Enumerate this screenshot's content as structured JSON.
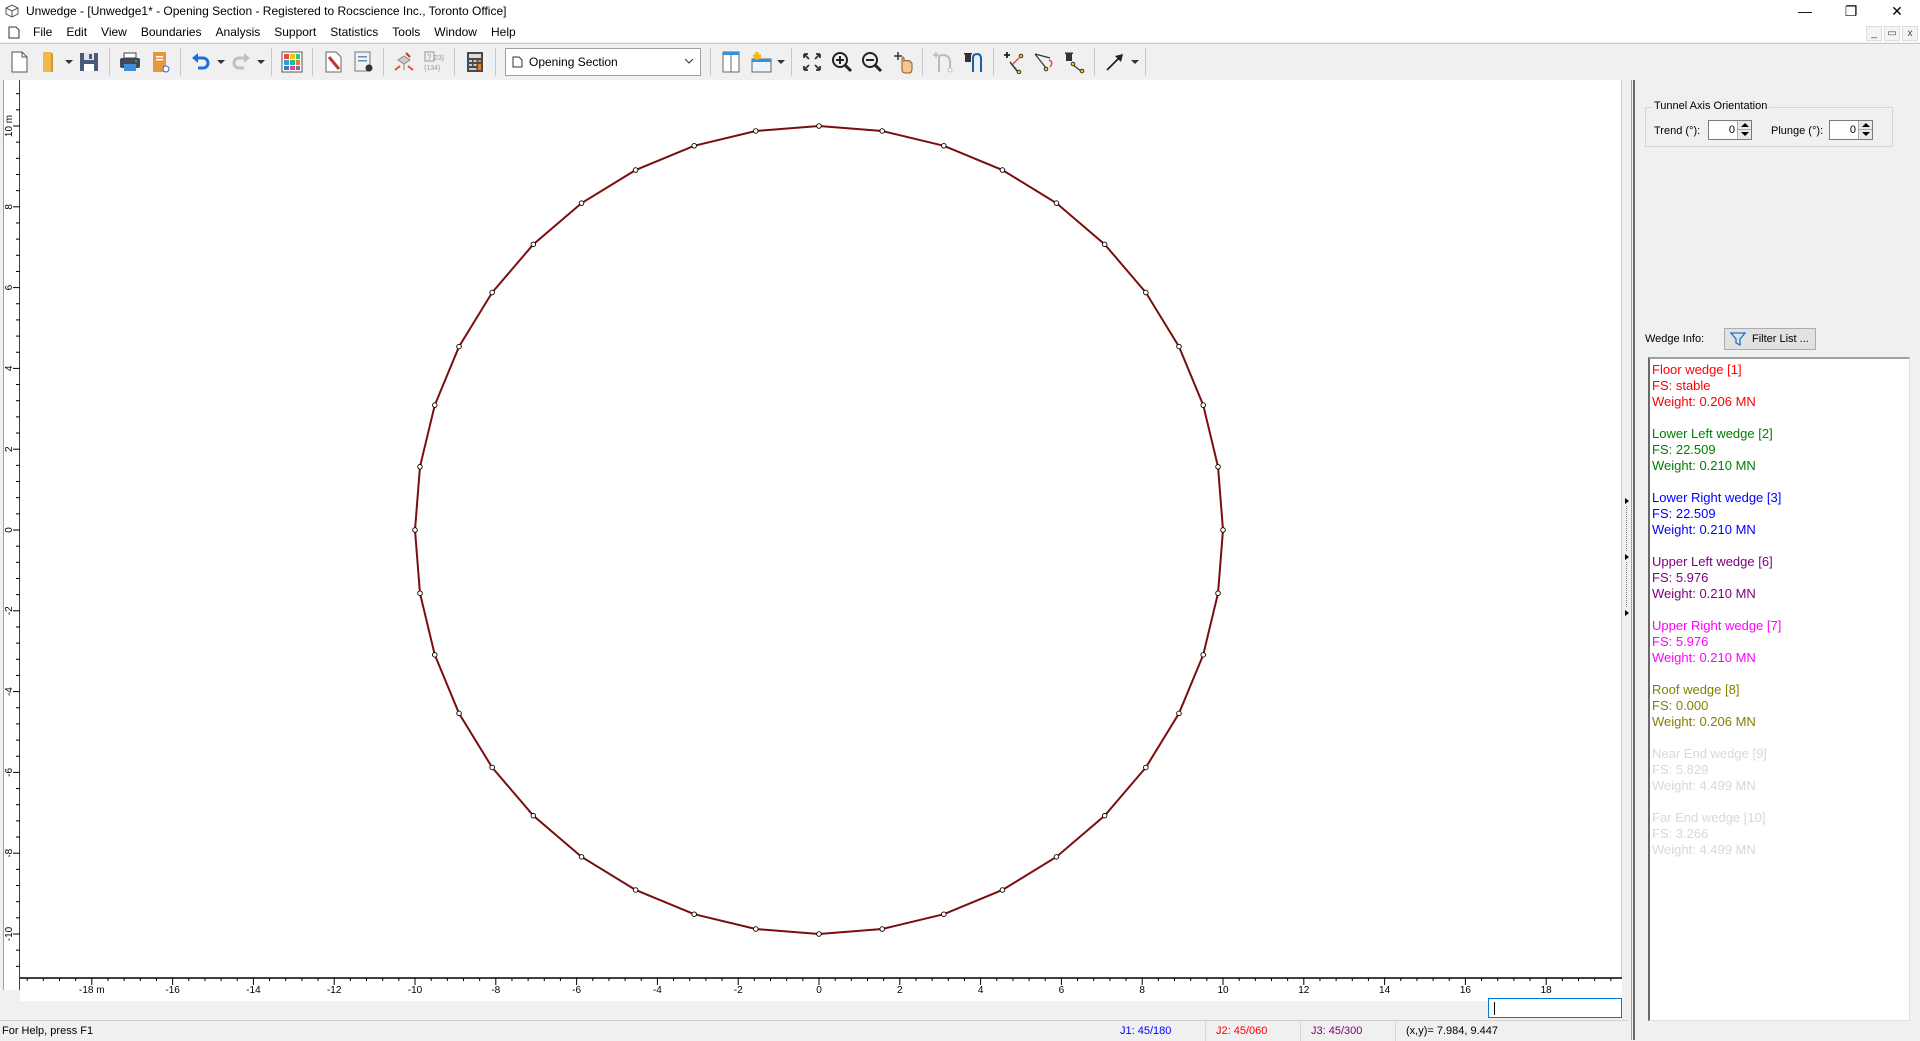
{
  "window": {
    "title": "Unwedge - [Unwedge1* - Opening Section - Registered to Rocscience Inc., Toronto Office]",
    "controls": {
      "minimize": "—",
      "restore": "❐",
      "close": "✕"
    },
    "mdi_controls": {
      "minimize": "_",
      "restore": "🗗",
      "close": "x"
    }
  },
  "menu": {
    "items": [
      "File",
      "Edit",
      "View",
      "Boundaries",
      "Analysis",
      "Support",
      "Statistics",
      "Tools",
      "Window",
      "Help"
    ]
  },
  "toolbar": {
    "buttons": [
      {
        "icon": "new-file-icon"
      },
      {
        "icon": "open-folder-icon",
        "dropdown": true
      },
      {
        "icon": "save-icon"
      },
      {
        "icon": "print-icon"
      },
      {
        "icon": "export-icon"
      },
      {
        "icon": "undo-icon",
        "dropdown": true
      },
      {
        "icon": "redo-icon",
        "dropdown": true,
        "disabled": true
      },
      {
        "icon": "color-grid-icon"
      },
      {
        "icon": "edit-pen-icon"
      },
      {
        "icon": "settings-doc-icon"
      },
      {
        "icon": "compute-icon"
      },
      {
        "icon": "info-viewer-icon",
        "text": "{?23}{134}"
      },
      {
        "icon": "calculator-icon"
      },
      {
        "icon": "split-view-icon"
      },
      {
        "icon": "add-view-icon",
        "dropdown": true
      },
      {
        "icon": "zoom-extents-icon"
      },
      {
        "icon": "zoom-in-icon"
      },
      {
        "icon": "zoom-out-icon"
      },
      {
        "icon": "pan-icon"
      },
      {
        "icon": "add-boundary-icon",
        "disabled": true
      },
      {
        "icon": "delete-boundary-icon"
      },
      {
        "icon": "add-vertex-icon"
      },
      {
        "icon": "move-vertex-icon"
      },
      {
        "icon": "delete-vertex-icon"
      },
      {
        "icon": "arrow-icon",
        "dropdown": true
      }
    ],
    "view_select": {
      "value": "Opening Section"
    }
  },
  "canvas": {
    "y_ruler": {
      "unit": "m",
      "ticks": [
        10,
        8,
        6,
        4,
        2,
        0,
        -2,
        -4,
        -6,
        -8,
        -10
      ]
    },
    "x_ruler": {
      "unit": "m",
      "ticks": [
        -18,
        -16,
        -14,
        -12,
        -10,
        -8,
        -6,
        -4,
        -2,
        0,
        2,
        4,
        6,
        8,
        10,
        12,
        14,
        16,
        18
      ]
    },
    "opening": {
      "shape": "circle",
      "center": [
        0,
        0
      ],
      "radius_m": 10,
      "vertex_count": 40,
      "color": "#7a0e0e"
    }
  },
  "command_input": {
    "value": ""
  },
  "right_panel": {
    "tunnel_axis": {
      "title": "Tunnel Axis Orientation",
      "trend_label": "Trend (°):",
      "trend_value": "0",
      "plunge_label": "Plunge (°):",
      "plunge_value": "0"
    },
    "wedge_info_label": "Wedge Info:",
    "filter_button": "Filter List ...",
    "wedges": [
      {
        "name": "Floor wedge [1]",
        "fs": "FS: stable",
        "weight": "Weight: 0.206 MN",
        "color": "#ff0000"
      },
      {
        "name": "Lower Left wedge [2]",
        "fs": "FS: 22.509",
        "weight": "Weight: 0.210 MN",
        "color": "#008000"
      },
      {
        "name": "Lower Right wedge [3]",
        "fs": "FS: 22.509",
        "weight": "Weight: 0.210 MN",
        "color": "#0000ff"
      },
      {
        "name": "Upper Left wedge [6]",
        "fs": "FS: 5.976",
        "weight": "Weight: 0.210 MN",
        "color": "#800080"
      },
      {
        "name": "Upper Right wedge [7]",
        "fs": "FS: 5.976",
        "weight": "Weight: 0.210 MN",
        "color": "#ff00ff"
      },
      {
        "name": "Roof wedge [8]",
        "fs": "FS: 0.000",
        "weight": "Weight: 0.206 MN",
        "color": "#808000"
      },
      {
        "name": "Near End wedge [9]",
        "fs": "FS: 5.829",
        "weight": "Weight: 4.499 MN",
        "color": "#d8d8d8"
      },
      {
        "name": "Far End wedge [10]",
        "fs": "FS: 3.266",
        "weight": "Weight: 4.499 MN",
        "color": "#d8d8d8"
      }
    ]
  },
  "status_bar": {
    "help": "For Help, press F1",
    "j1": {
      "text": "J1: 45/180",
      "color": "#0000ff"
    },
    "j2": {
      "text": "J2: 45/060",
      "color": "#ff0000"
    },
    "j3": {
      "text": "J3: 45/300",
      "color": "#800080"
    },
    "coords": "(x,y)= 7.984, 9.447"
  }
}
